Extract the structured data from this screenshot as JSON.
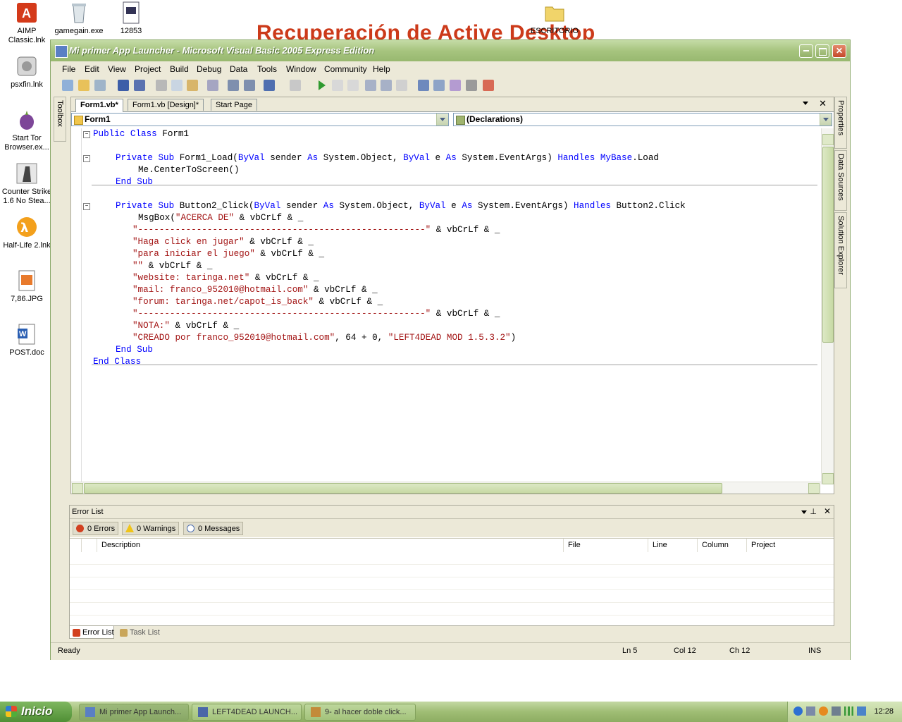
{
  "desktop": {
    "banner": "Recuperación de Active Desktop",
    "icons": [
      {
        "label": "AIMP Classic.lnk"
      },
      {
        "label": "gamegain.exe"
      },
      {
        "label": "12853"
      },
      {
        "label": "ESCRITORIO"
      },
      {
        "label": "psxfin.lnk"
      },
      {
        "label": "Start Tor Browser.ex..."
      },
      {
        "label": "Counter Strike 1.6 No Stea..."
      },
      {
        "label": "Half-Life 2.lnk"
      },
      {
        "label": "7,86.JPG"
      },
      {
        "label": "POST.doc"
      }
    ]
  },
  "window": {
    "title": "Mi primer App Launcher - Microsoft Visual Basic 2005 Express Edition",
    "menu": [
      "File",
      "Edit",
      "View",
      "Project",
      "Build",
      "Debug",
      "Data",
      "Tools",
      "Window",
      "Community",
      "Help"
    ],
    "toolbox_label": "Toolbox",
    "tabs": [
      "Form1.vb*",
      "Form1.vb [Design]*",
      "Start Page"
    ],
    "class_combo": "Form1",
    "method_combo": "(Declarations)",
    "side_tabs": [
      "Properties",
      "Data Sources",
      "Solution Explorer"
    ]
  },
  "code": {
    "l1a": "Public Class",
    "l1b": " Form1",
    "l3a": "Private Sub",
    "l3b": " Form1_Load(",
    "l3c": "ByVal",
    "l3d": " sender ",
    "l3e": "As",
    "l3f": " System.Object, ",
    "l3g": "ByVal",
    "l3h": " e ",
    "l3i": "As",
    "l3j": " System.EventArgs) ",
    "l3k": "Handles",
    "l3l": " ",
    "l3m": "MyBase",
    "l3n": ".Load",
    "l4": "Me.CenterToScreen()",
    "l5": "End Sub",
    "l7a": "Private Sub",
    "l7b": " Button2_Click(",
    "l7c": "ByVal",
    "l7d": " sender ",
    "l7e": "As",
    "l7f": " System.Object, ",
    "l7g": "ByVal",
    "l7h": " e ",
    "l7i": "As",
    "l7j": " System.EventArgs) ",
    "l7k": "Handles",
    "l7l": " Button2.Click",
    "l8a": "MsgBox(",
    "l8b": "\"ACERCA DE\"",
    "l8c": " & vbCrLf & _",
    "l9a": "\"------------------------------------------------------\"",
    "l9b": " & vbCrLf & _",
    "l10a": "\"Haga click en jugar\"",
    "l10b": " & vbCrLf & _",
    "l11a": "\"para iniciar el juego\"",
    "l11b": " & vbCrLf & _",
    "l12a": "\"\"",
    "l12b": " & vbCrLf & _",
    "l13a": "\"website: taringa.net\"",
    "l13b": " & vbCrLf & _",
    "l14a": "\"mail: franco_952010@hotmail.com\"",
    "l14b": " & vbCrLf & _",
    "l15a": "\"forum: taringa.net/capot_is_back\"",
    "l15b": " & vbCrLf & _",
    "l16a": "\"------------------------------------------------------\"",
    "l16b": " & vbCrLf & _",
    "l17a": "\"NOTA:\"",
    "l17b": " & vbCrLf & _",
    "l18a": "\"CREADO por franco_952010@hotmail.com\"",
    "l18b": ", 64 + 0, ",
    "l18c": "\"LEFT4DEAD MOD 1.5.3.2\"",
    "l18d": ")",
    "l19": "End Sub",
    "l20": "End Class"
  },
  "error_list": {
    "title": "Error List",
    "errors": "0 Errors",
    "warnings": "0 Warnings",
    "messages": "0 Messages",
    "columns": [
      "Description",
      "File",
      "Line",
      "Column",
      "Project"
    ],
    "bottom_tabs": [
      "Error List",
      "Task List"
    ]
  },
  "status": {
    "ready": "Ready",
    "ln": "Ln 5",
    "col": "Col 12",
    "ch": "Ch 12",
    "ins": "INS"
  },
  "taskbar": {
    "start": "Inicio",
    "tasks": [
      "Mi primer App Launch...",
      "LEFT4DEAD LAUNCH...",
      "9- al hacer doble click..."
    ],
    "clock": "12:28"
  },
  "colors": {
    "keyword": "#0000ff",
    "string": "#a31515",
    "xp_green": "#98b86f"
  }
}
